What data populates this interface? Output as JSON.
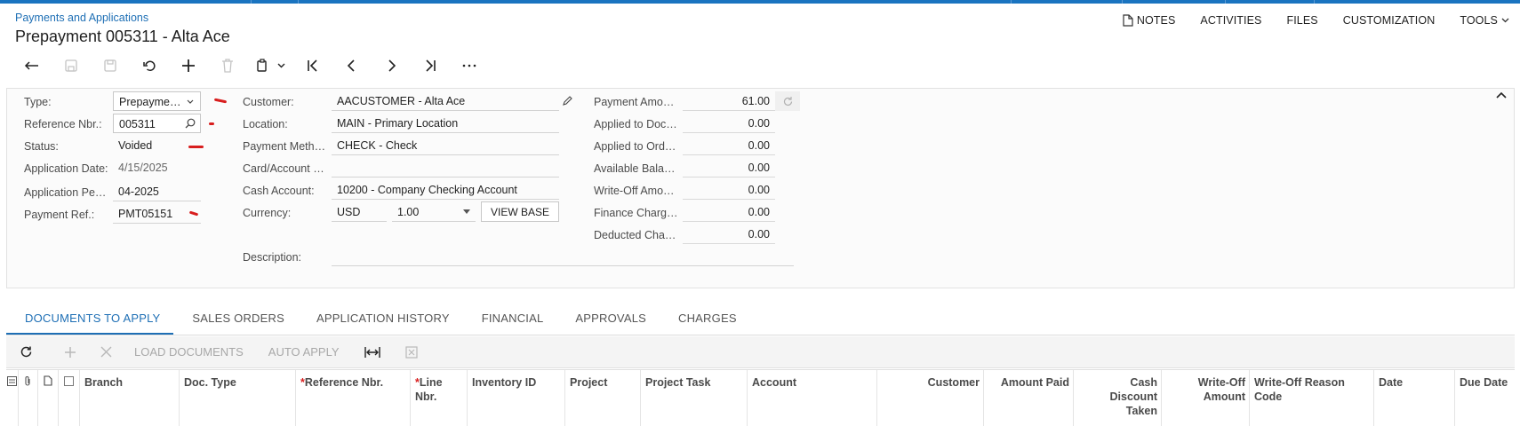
{
  "breadcrumb": "Payments and Applications",
  "title": "Prepayment 005311 - Alta Ace",
  "top_links": [
    {
      "icon": "notes-icon",
      "label": "NOTES"
    },
    {
      "label": "ACTIVITIES"
    },
    {
      "label": "FILES"
    },
    {
      "label": "CUSTOMIZATION"
    },
    {
      "label": "TOOLS"
    }
  ],
  "toolbar": [
    "back-icon",
    "save-close-icon",
    "save-icon",
    "undo-icon",
    "add-icon",
    "delete-icon",
    "copy-paste-icon",
    "first-record-icon",
    "previous-record-icon",
    "next-record-icon",
    "last-record-icon",
    "more-icon"
  ],
  "form": {
    "type_label": "Type:",
    "type_value": "Prepayme…",
    "ref_label": "Reference Nbr.:",
    "ref_value": "005311",
    "status_label": "Status:",
    "status_value": "Voided",
    "appdate_label": "Application Date:",
    "appdate_value": "4/15/2025",
    "appperiod_label": "Application Pe…",
    "appperiod_value": "04-2025",
    "payref_label": "Payment Ref.:",
    "payref_value": "PMT05151",
    "customer_label": "Customer:",
    "customer_value": "AACUSTOMER - Alta Ace",
    "location_label": "Location:",
    "location_value": "MAIN - Primary Location",
    "paymethod_label": "Payment Meth…",
    "paymethod_value": "CHECK - Check",
    "cardaccount_label": "Card/Account …",
    "cardaccount_value": "",
    "cashaccount_label": "Cash Account:",
    "cashaccount_value": "10200 - Company Checking Account",
    "currency_label": "Currency:",
    "currency_value": "USD",
    "rate_value": "1.00",
    "viewbase_label": "VIEW BASE",
    "description_label": "Description:",
    "description_value": ""
  },
  "amounts": [
    {
      "label": "Payment Amo…",
      "value": "61.00"
    },
    {
      "label": "Applied to Doc…",
      "value": "0.00"
    },
    {
      "label": "Applied to Ord…",
      "value": "0.00"
    },
    {
      "label": "Available Bala…",
      "value": "0.00"
    },
    {
      "label": "Write-Off Amo…",
      "value": "0.00"
    },
    {
      "label": "Finance Charg…",
      "value": "0.00"
    },
    {
      "label": "Deducted Cha…",
      "value": "0.00"
    }
  ],
  "tabs": [
    "DOCUMENTS TO APPLY",
    "SALES ORDERS",
    "APPLICATION HISTORY",
    "FINANCIAL",
    "APPROVALS",
    "CHARGES"
  ],
  "grid_toolbar": {
    "load_documents": "LOAD DOCUMENTS",
    "auto_apply": "AUTO APPLY"
  },
  "columns": [
    {
      "label": "Branch"
    },
    {
      "label": "Doc. Type"
    },
    {
      "label": "Reference Nbr.",
      "required": "*"
    },
    {
      "label": "Line Nbr.",
      "required": "*"
    },
    {
      "label": "Inventory ID"
    },
    {
      "label": "Project"
    },
    {
      "label": "Project Task"
    },
    {
      "label": "Account"
    },
    {
      "label": "Customer"
    },
    {
      "label": "Amount Paid"
    },
    {
      "label": "Cash Discount Taken"
    },
    {
      "label": "Write-Off Amount"
    },
    {
      "label": "Write-Off Reason Code"
    },
    {
      "label": "Date"
    },
    {
      "label": "Due Date"
    }
  ],
  "colors": {
    "accent": "#1e6fb5",
    "topbar": "#1a74c0",
    "annotation": "#d81e1e"
  }
}
